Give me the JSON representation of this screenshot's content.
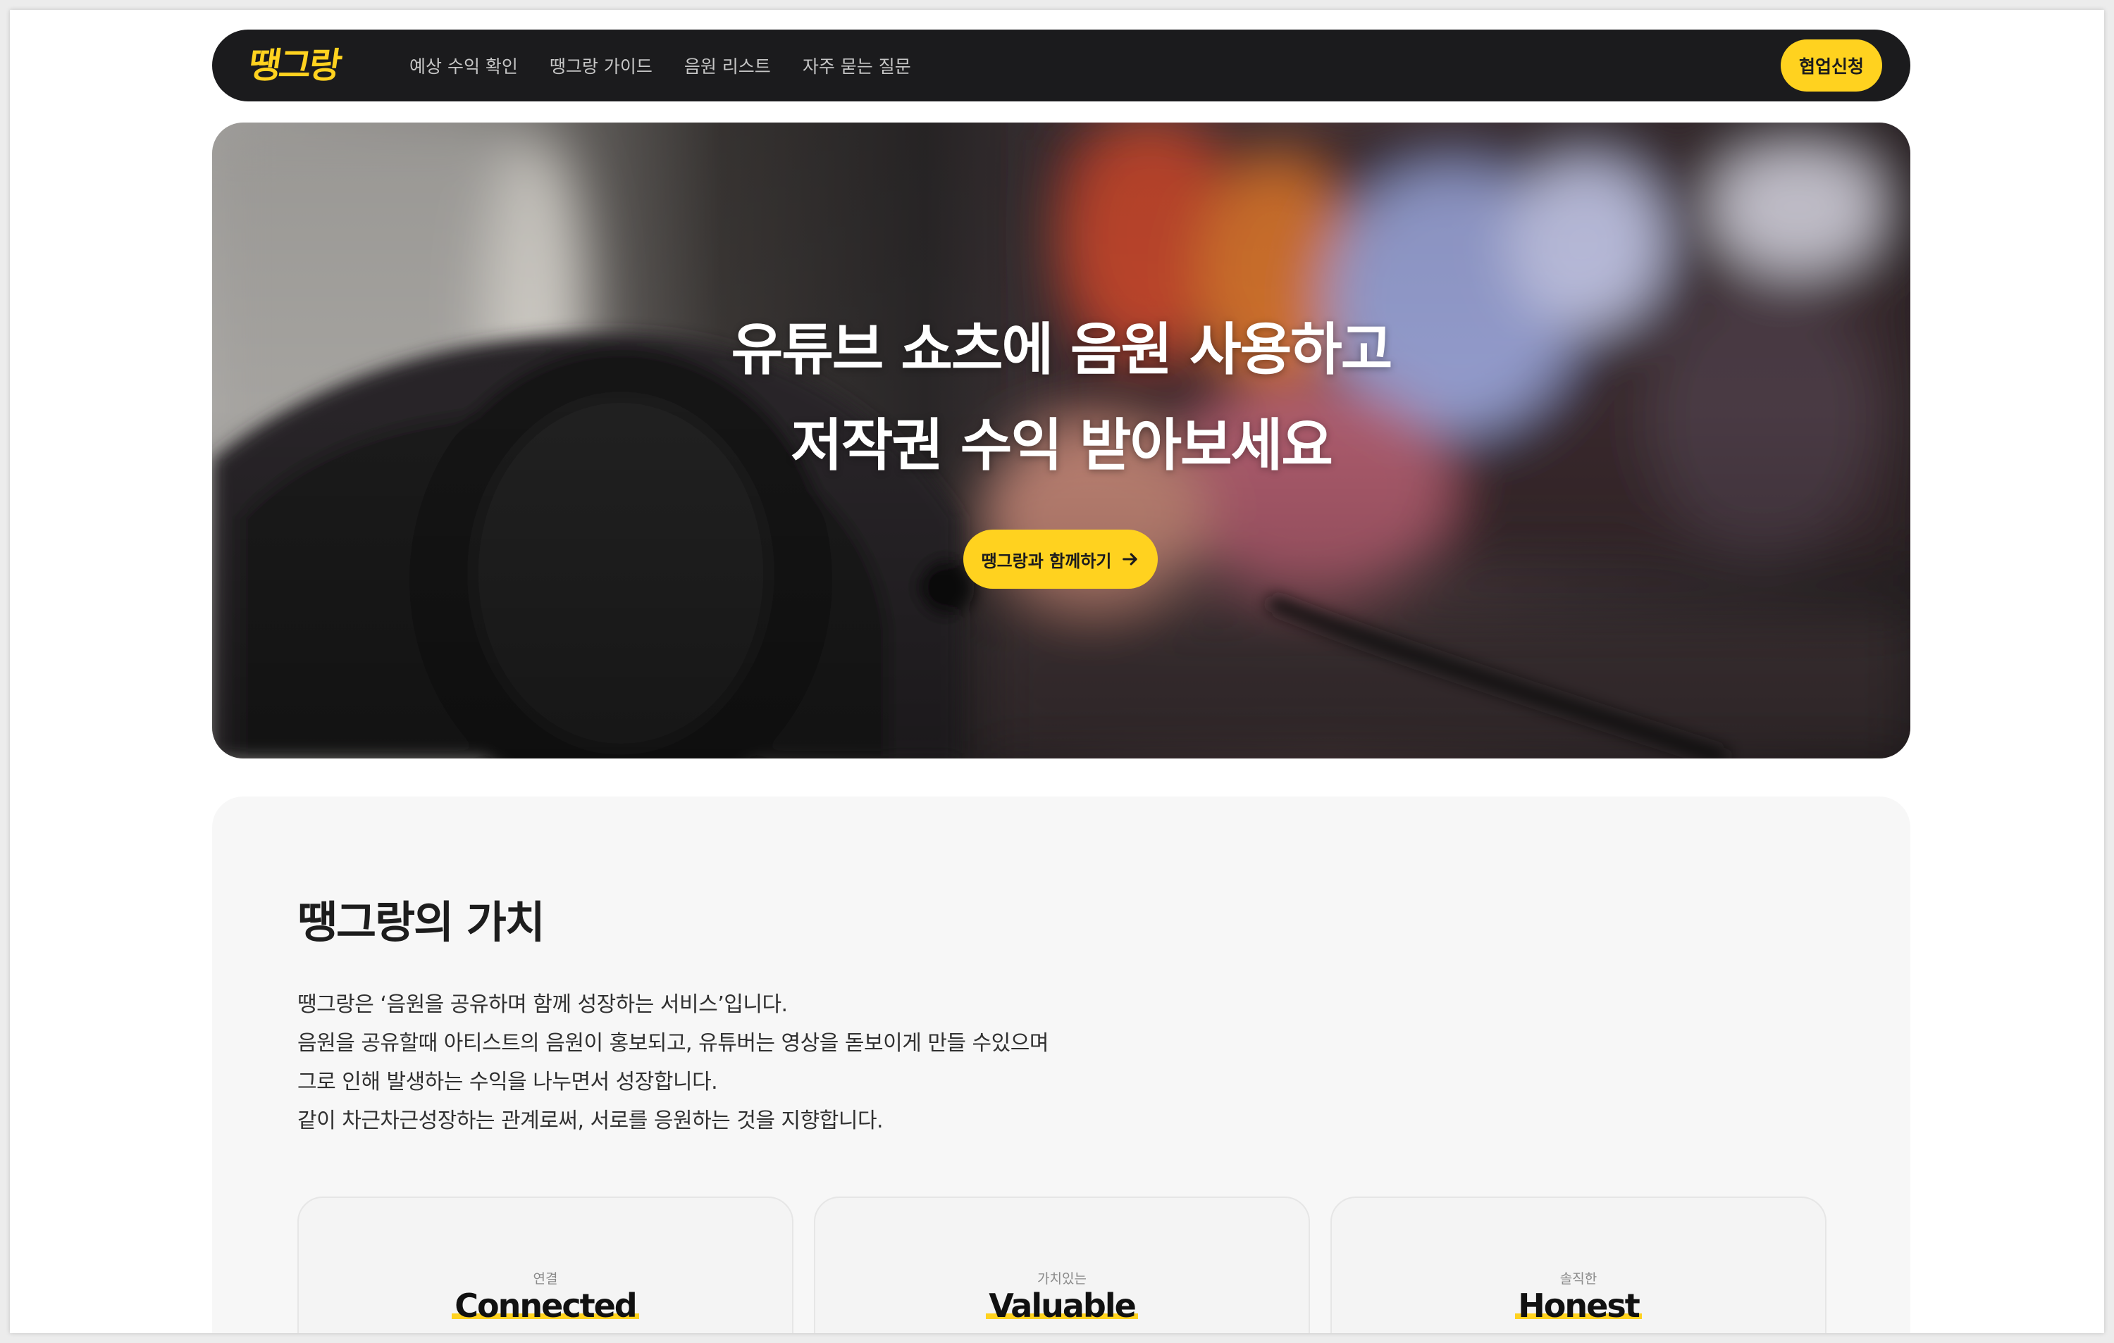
{
  "nav": {
    "logo": "땡그랑",
    "items": [
      {
        "label": "예상 수익 확인"
      },
      {
        "label": "땡그랑 가이드"
      },
      {
        "label": "음원 리스트"
      },
      {
        "label": "자주 묻는 질문"
      }
    ],
    "cta_label": "협업신청"
  },
  "hero": {
    "title_line1": "유튜브 쇼츠에 음원 사용하고",
    "title_line2": "저작권 수익 받아보세요",
    "cta_label": "땡그랑과 함께하기",
    "cta_icon": "arrow-right-icon"
  },
  "values": {
    "title": "땡그랑의 가치",
    "description": [
      "땡그랑은 ‘음원을 공유하며 함께 성장하는 서비스’입니다.",
      "음원을 공유할때 아티스트의 음원이 홍보되고, 유튜버는 영상을 돋보이게 만들 수있으며",
      "그로 인해 발생하는 수익을 나누면서 성장합니다.",
      "같이 차근차근성장하는 관계로써, 서로를 응원하는 것을 지향합니다."
    ],
    "cards": [
      {
        "small": "연결",
        "word": "Connected"
      },
      {
        "small": "가치있는",
        "word": "Valuable"
      },
      {
        "small": "솔직한",
        "word": "Honest"
      }
    ]
  },
  "colors": {
    "accent": "#ffd21f",
    "nav_bg": "#1b1b1d",
    "section_bg": "#f7f7f7"
  }
}
